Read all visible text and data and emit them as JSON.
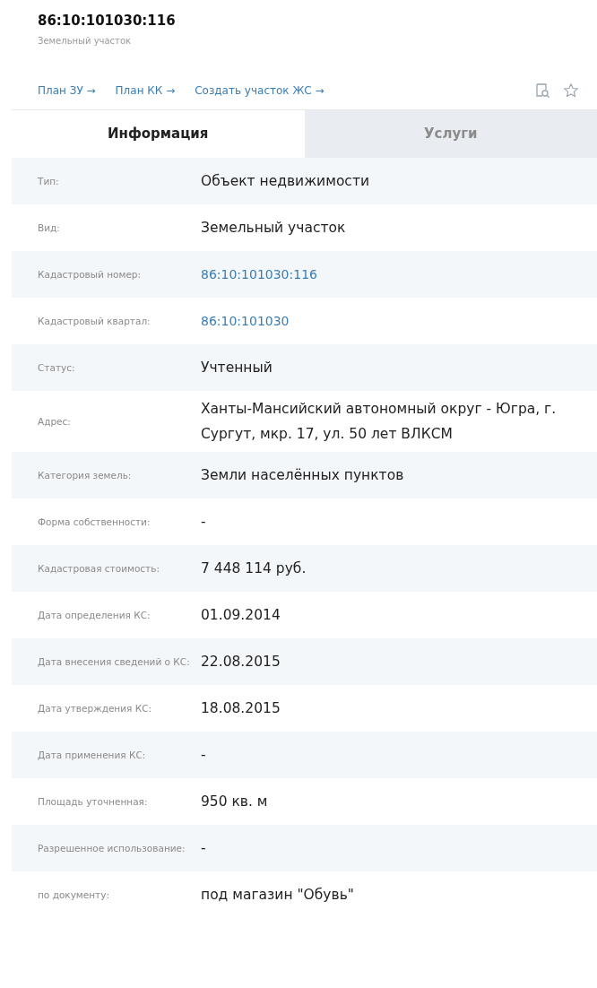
{
  "header": {
    "title": "86:10:101030:116",
    "subtitle": "Земельный участок"
  },
  "links": [
    "План ЗУ →",
    "План КК →",
    "Создать участок ЖС →"
  ],
  "tabs": [
    {
      "label": "Информация",
      "selected": true
    },
    {
      "label": "Услуги",
      "selected": false
    }
  ],
  "rows": [
    {
      "label": "Тип:",
      "value": "Объект недвижимости",
      "kind": "text"
    },
    {
      "label": "Вид:",
      "value": "Земельный участок",
      "kind": "text"
    },
    {
      "label": "Кадастровый номер:",
      "value": "86:10:101030:116",
      "kind": "link"
    },
    {
      "label": "Кадастровый квартал:",
      "value": "86:10:101030",
      "kind": "link"
    },
    {
      "label": "Статус:",
      "value": "Учтенный",
      "kind": "text"
    },
    {
      "label": "Адрес:",
      "value": "Ханты-Мансийский автономный округ - Югра, г. Сургут, мкр. 17, ул. 50 лет ВЛКСМ",
      "kind": "text"
    },
    {
      "label": "Категория земель:",
      "value": "Земли населённых пунктов",
      "kind": "text"
    },
    {
      "label": "Форма собственности:",
      "value": "-",
      "kind": "text"
    },
    {
      "label": "Кадастровая стоимость:",
      "value": "7 448 114 руб.",
      "kind": "text"
    },
    {
      "label": "Дата определения КС:",
      "value": "01.09.2014",
      "kind": "text"
    },
    {
      "label": "Дата внесения сведений о КС:",
      "value": "22.08.2015",
      "kind": "text"
    },
    {
      "label": "Дата утверждения КС:",
      "value": "18.08.2015",
      "kind": "text"
    },
    {
      "label": "Дата применения КС:",
      "value": "-",
      "kind": "text"
    },
    {
      "label": "Площадь уточненная:",
      "value": "950 кв. м",
      "kind": "text"
    },
    {
      "label": "Разрешенное использование:",
      "value": "-",
      "kind": "text"
    },
    {
      "label": "по документу:",
      "value": "под магазин \"Обувь\"",
      "kind": "text"
    }
  ]
}
